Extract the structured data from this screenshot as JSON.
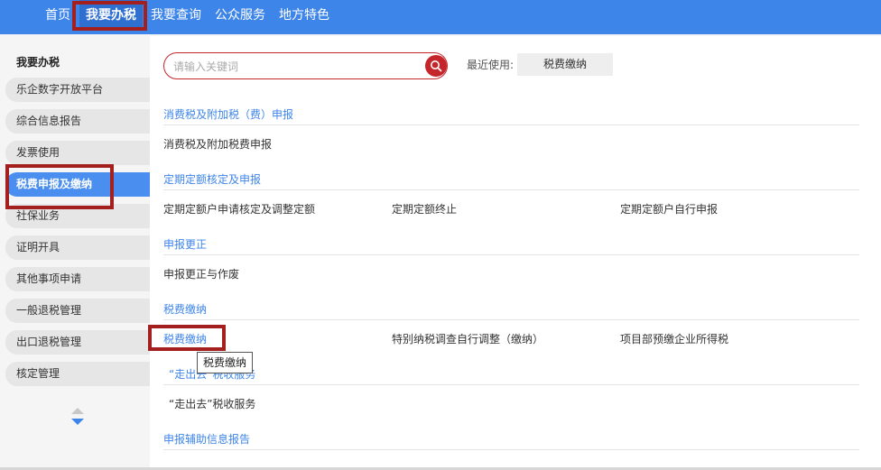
{
  "topnav": {
    "items": [
      "首页",
      "我要办税",
      "我要查询",
      "公众服务",
      "地方特色"
    ]
  },
  "sidebar": {
    "title": "我要办税",
    "items": [
      "乐企数字开放平台",
      "综合信息报告",
      "发票使用",
      "税费申报及缴纳",
      "社保业务",
      "证明开具",
      "其他事项申请",
      "一般退税管理",
      "出口退税管理",
      "核定管理"
    ]
  },
  "search": {
    "placeholder": "请输入关键词",
    "recent_label": "最近使用:",
    "recent_item": "税费缴纳"
  },
  "sections": [
    {
      "title": "消费税及附加税（费）申报",
      "items": [
        "消费税及附加税费申报"
      ]
    },
    {
      "title": "定期定额核定及申报",
      "items": [
        "定期定额户申请核定及调整定额",
        "定期定额终止",
        "定期定额户自行申报"
      ]
    },
    {
      "title": "申报更正",
      "items": [
        "申报更正与作废"
      ]
    },
    {
      "title": "税费缴纳",
      "items": [
        "税费缴纳",
        "特别纳税调查自行调整（缴纳）",
        "项目部预缴企业所得税"
      ]
    },
    {
      "title": "“走出去”税收服务",
      "items": [
        "“走出去”税收服务"
      ]
    },
    {
      "title": "申报辅助信息报告",
      "items": []
    }
  ],
  "tooltip": "税费缴纳",
  "colors": {
    "nav_bg": "#3e85e9",
    "active_side": "#4a8ff0",
    "search_red": "#c4262b",
    "highlight_red": "#a3201e",
    "link_blue": "#3e85e9"
  }
}
